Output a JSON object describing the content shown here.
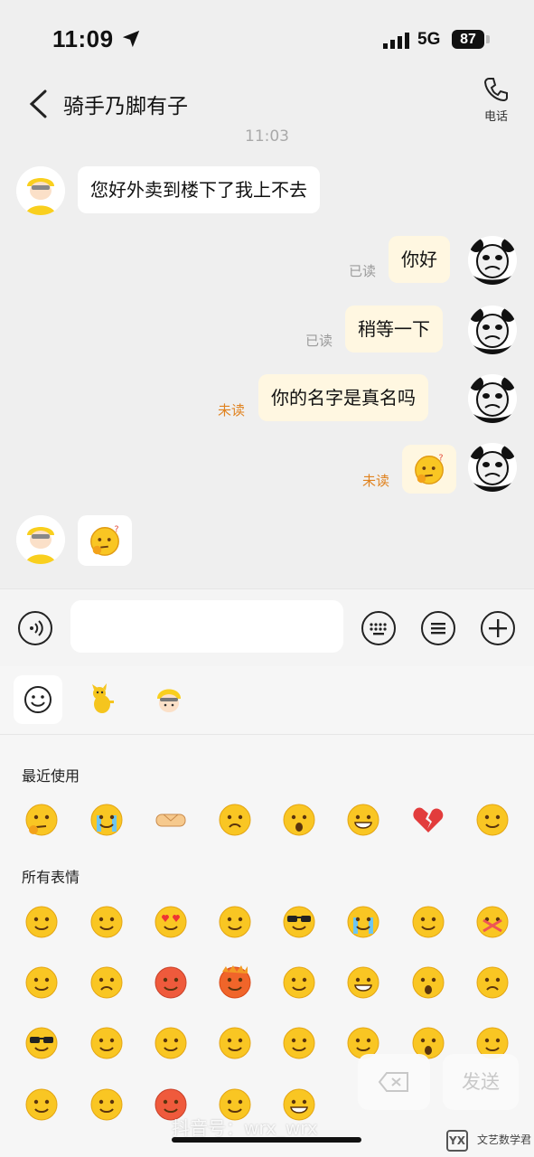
{
  "status_bar": {
    "time": "11:09",
    "network": "5G",
    "battery": "87"
  },
  "header": {
    "title": "骑手乃脚有子",
    "call_label": "电话"
  },
  "chat": {
    "timestamp": "11:03",
    "messages": [
      {
        "side": "in",
        "text": "您好外卖到楼下了我上不去"
      },
      {
        "side": "out",
        "text": "你好",
        "status": "已读"
      },
      {
        "side": "out",
        "text": "稍等一下",
        "status": "已读"
      },
      {
        "side": "out",
        "text": "你的名字是真名吗",
        "status": "未读"
      },
      {
        "side": "out",
        "emoji": "thinking-face",
        "status": "未读"
      },
      {
        "side": "in",
        "emoji": "thinking-face"
      }
    ]
  },
  "input": {
    "placeholder": "",
    "value": ""
  },
  "emoji_panel": {
    "tabs": [
      "smiley-tab",
      "dog-sticker-tab",
      "rider-sticker-tab"
    ],
    "recent_label": "最近使用",
    "all_label": "所有表情",
    "recent": [
      "thinking",
      "crying",
      "handshake",
      "frown",
      "screaming",
      "grin",
      "broken-heart",
      "worried"
    ],
    "all_rows": [
      [
        "smile",
        "shy",
        "heart-eyes",
        "drool",
        "sunglasses",
        "crying",
        "happy-closed-eyes",
        "zip-mouth"
      ],
      [
        "sleeping",
        "sad",
        "embarrassed",
        "angry",
        "wink-tongue",
        "laughing",
        "shocked",
        "neutral"
      ],
      [
        "cool",
        "doubt",
        "vomit",
        "tired",
        "cover-mouth",
        "faint",
        "surprised",
        "confused"
      ],
      [
        "shy-smile",
        "pout",
        "sweat-angry",
        "sweat-smile",
        "grin-2",
        "",
        "",
        ""
      ]
    ],
    "delete_label": "⌫",
    "send_label": "发送"
  },
  "watermark": "抖音号：wrx_wrx",
  "brand": {
    "mark": "YX",
    "name": "文艺数学君"
  },
  "colors": {
    "bubble_out": "#fff7e1",
    "unread": "#e0821e",
    "emoji_yellow": "#f9c623"
  }
}
